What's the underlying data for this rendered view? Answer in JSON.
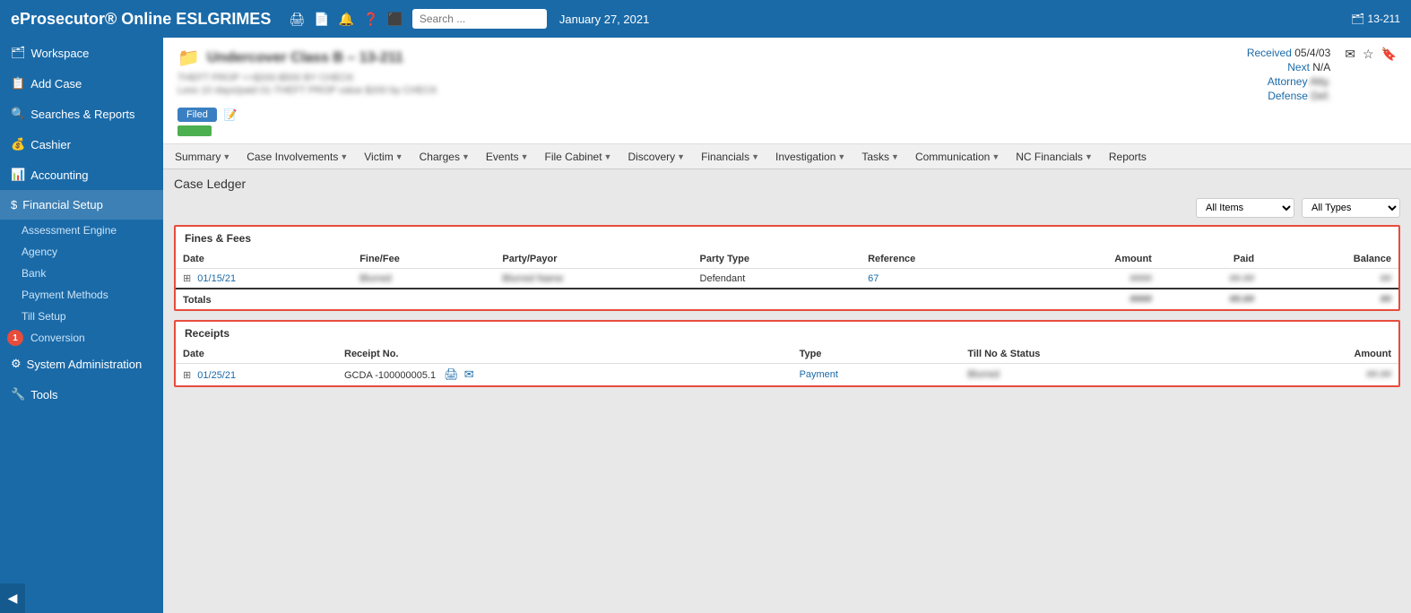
{
  "app": {
    "title": "eProsecutor® Online ESLGRIMES",
    "date": "January 27, 2021",
    "case_id": "13-211",
    "search_placeholder": "Search ..."
  },
  "header_icons": [
    "print",
    "document",
    "bell",
    "help",
    "exit"
  ],
  "sidebar": {
    "items": [
      {
        "id": "workspace",
        "label": "Workspace",
        "icon": "🗂",
        "badge": null
      },
      {
        "id": "add-case",
        "label": "Add Case",
        "icon": "📋",
        "badge": null
      },
      {
        "id": "searches",
        "label": "Searches & Reports",
        "icon": "🔍",
        "badge": null
      },
      {
        "id": "cashier",
        "label": "Cashier",
        "icon": "💰",
        "badge": null
      },
      {
        "id": "accounting",
        "label": "Accounting",
        "icon": "📊",
        "badge": null
      },
      {
        "id": "financial-setup",
        "label": "Financial Setup",
        "icon": "$",
        "badge": null
      },
      {
        "id": "system-admin",
        "label": "System Administration",
        "icon": "⚙",
        "badge": null
      },
      {
        "id": "tools",
        "label": "Tools",
        "icon": "🔧",
        "badge": null
      }
    ],
    "sub_items": [
      "Assessment Engine",
      "Agency",
      "Bank",
      "Payment Methods",
      "Till Setup",
      "Conversion"
    ],
    "conversion_badge": "1"
  },
  "case_header": {
    "title": "Undercover Class B – 13-211",
    "subtitle1": "THEFT PROP ++$200-$500 BY CHECK",
    "subtitle2": "Less 10 days/paid 01-THEFT PROP value $200 by CHECK",
    "received": "05/4/03",
    "next": "N/A",
    "attorney": "Atty.",
    "defense": "Def.",
    "status": "Filed"
  },
  "nav_tabs": [
    {
      "label": "Summary",
      "has_arrow": true
    },
    {
      "label": "Case Involvements",
      "has_arrow": true
    },
    {
      "label": "Victim",
      "has_arrow": true
    },
    {
      "label": "Charges",
      "has_arrow": true
    },
    {
      "label": "Events",
      "has_arrow": true
    },
    {
      "label": "File Cabinet",
      "has_arrow": true
    },
    {
      "label": "Discovery",
      "has_arrow": true
    },
    {
      "label": "Financials",
      "has_arrow": true
    },
    {
      "label": "Investigation",
      "has_arrow": true
    },
    {
      "label": "Tasks",
      "has_arrow": true
    },
    {
      "label": "Communication",
      "has_arrow": true
    },
    {
      "label": "NC Financials",
      "has_arrow": true
    },
    {
      "label": "Reports",
      "has_arrow": false
    }
  ],
  "page_title": "Case Ledger",
  "filters": {
    "items_label": "All Items",
    "types_label": "All Types",
    "items_options": [
      "All Items"
    ],
    "types_options": [
      "All Types"
    ]
  },
  "fines_fees": {
    "section_title": "Fines & Fees",
    "columns": [
      "Date",
      "Fine/Fee",
      "Party/Payor",
      "Party Type",
      "Reference",
      "Amount",
      "Paid",
      "Balance"
    ],
    "rows": [
      {
        "date": "01/15/21",
        "fine_fee": "Blurred",
        "party_payor": "Blurred Name",
        "party_type": "Defendant",
        "reference": "67",
        "amount": "####",
        "paid": "##.##",
        "balance": "##"
      }
    ],
    "totals_label": "Totals",
    "totals_amount": "####",
    "totals_paid": "##.##",
    "totals_balance": "##"
  },
  "receipts": {
    "section_title": "Receipts",
    "columns": [
      "Date",
      "Receipt No.",
      "Type",
      "Till No & Status",
      "Amount"
    ],
    "rows": [
      {
        "date": "01/25/21",
        "receipt_no": "GCDA -100000005.1",
        "type": "Payment",
        "till_status": "Blurred",
        "amount": "##.##"
      }
    ]
  }
}
